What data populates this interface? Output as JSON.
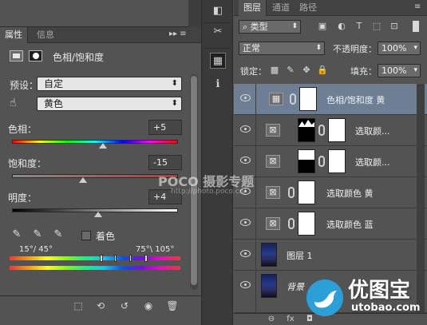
{
  "properties_panel": {
    "tabs": [
      "属性",
      "信息"
    ],
    "menu_glyph": "▸▸ ≡",
    "title": "色相/饱和度",
    "preset_label": "预设：",
    "preset_value": "自定",
    "channel_value": "黄色",
    "hue_label": "色相：",
    "hue_value": "+5",
    "hue_fraction": 0.55,
    "saturation_label": "饱和度：",
    "saturation_value": "-15",
    "saturation_fraction": 0.43,
    "lightness_label": "明度：",
    "lightness_value": "+4",
    "lightness_fraction": 0.52,
    "colorize_label": "着色",
    "range_left": "15°/ 45°",
    "range_right": "75°\\ 105°"
  },
  "mid_tools": [
    "history-icon",
    "brush-settings-icon",
    "adjustments-icon",
    "info-icon"
  ],
  "layers_panel": {
    "tabs": [
      "图层",
      "通道",
      "路径"
    ],
    "filter_kind": "类型",
    "filter_icons": [
      "image-filter-icon",
      "adjustment-filter-icon",
      "type-filter-icon",
      "shape-filter-icon",
      "smart-object-filter-icon"
    ],
    "blend_mode": "正常",
    "opacity_label": "不透明度：",
    "opacity_value": "100%",
    "lock_label": "锁定：",
    "fill_label": "填充：",
    "fill_value": "100%",
    "layers": [
      {
        "name": "色相/饱和度 黄",
        "kind": "adjustment",
        "selected": true
      },
      {
        "name": "选取颜...",
        "kind": "adjustment",
        "selected": false
      },
      {
        "name": "选取颜...",
        "kind": "adjustment",
        "selected": false
      },
      {
        "name": "选取颜色 黄",
        "kind": "adjustment",
        "selected": false
      },
      {
        "name": "选取颜色 蓝",
        "kind": "adjustment",
        "selected": false
      },
      {
        "name": "图层 1",
        "kind": "pixel",
        "selected": false
      },
      {
        "name": "背景",
        "kind": "pixel",
        "selected": false
      }
    ]
  },
  "watermarks": {
    "poco": "POCO 摄影专题",
    "poco_url": "http://photo.poco.cn/",
    "brand": "优图宝",
    "brand_url": "utobao.com"
  },
  "colors": {
    "panel_bg": "#535353",
    "selected_layer": "#6e7f95",
    "brand_blue": "#2a9fd8"
  }
}
